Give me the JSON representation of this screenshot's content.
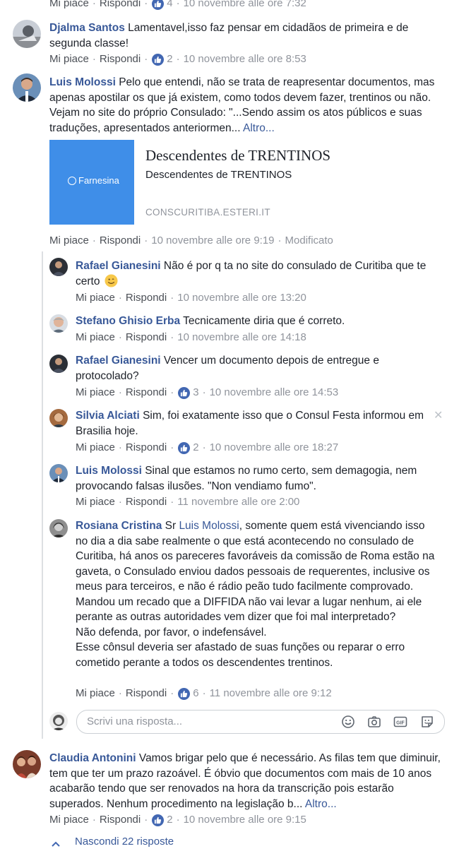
{
  "top_meta": {
    "like": "Mi piace",
    "reply": "Rispondi",
    "count": "4",
    "time": "10 novembre alle ore 7:32"
  },
  "comments": [
    {
      "author": "Djalma Santos",
      "text": "Lamentavel,isso faz pensar em cidadãos de primeira e de segunda classe!",
      "like": "Mi piace",
      "reply": "Rispondi",
      "count": "2",
      "time": "10 novembre alle ore 8:53"
    },
    {
      "author": "Luis Molossi",
      "text": "Pelo que entendi, não se trata de reapresentar documentos, mas apenas apostilar os que já existem, como todos devem fazer, trentinos ou não. Vejam no site do próprio Consulado: \"...Sendo assim os atos públicos e suas traduções, apresentados anteriormen...",
      "more": "Altro...",
      "like": "Mi piace",
      "reply": "Rispondi",
      "time": "10 novembre alle ore 9:19",
      "edited": "Modificato",
      "preview": {
        "logo": "Farnesina",
        "title": "Descendentes de TRENTINOS",
        "desc": "Descendentes de TRENTINOS",
        "domain": "CONSCURITIBA.ESTERI.IT"
      }
    },
    {
      "author": "Claudia Antonini",
      "text": "Vamos brigar pelo que é necessário. As filas tem que diminuir, tem que ter um prazo razoável. É óbvio que documentos com mais de 10 anos acabarão tendo que ser renovados na hora da transcrição pois estarão superados. Nenhum procedimento na legislação b...",
      "more": "Altro...",
      "like": "Mi piace",
      "reply": "Rispondi",
      "count": "2",
      "time": "10 novembre alle ore 9:15"
    }
  ],
  "replies": [
    {
      "author": "Rafael Gianesini",
      "text": "Não é por q ta no site do consulado de Curitiba que te certo",
      "like": "Mi piace",
      "reply": "Rispondi",
      "time": "10 novembre alle ore 13:20"
    },
    {
      "author": "Stefano Ghisio Erba",
      "text": "Tecnicamente diria que é correto.",
      "like": "Mi piace",
      "reply": "Rispondi",
      "time": "10 novembre alle ore 14:18"
    },
    {
      "author": "Rafael Gianesini",
      "text": "Vencer um documento depois de entregue e protocolado?",
      "like": "Mi piace",
      "reply": "Rispondi",
      "count": "3",
      "time": "10 novembre alle ore 14:53"
    },
    {
      "author": "Silvia Alciati",
      "text": "Sim, foi exatamente isso que o Consul Festa informou em Brasilia hoje.",
      "like": "Mi piace",
      "reply": "Rispondi",
      "count": "2",
      "time": "10 novembre alle ore 18:27"
    },
    {
      "author": "Luis Molossi",
      "text": "Sinal que estamos no rumo certo, sem demagogia, nem provocando falsas ilusões. \"Non vendiamo fumo\".",
      "like": "Mi piace",
      "reply": "Rispondi",
      "time": "11 novembre alle ore 2:00"
    },
    {
      "author": "Rosiana Cristina",
      "prefix": "Sr",
      "mention": "Luis Molossi",
      "text": ", somente quem está vivenciando isso no dia a dia sabe realmente o que está acontecendo no consulado de Curitiba, há anos os pareceres favoráveis da comissão de Roma estão na gaveta, o Consulado enviou dados pessoais de requerentes, inclusive os meus para terceiros, e não é rádio peão tudo facilmente comprovado. Mandou um recado que a DIFFIDA não vai levar a lugar nenhum, ai ele perante as outras autoridades vem dizer que foi mal interpretado?",
      "text2": "Não defenda, por favor, o indefensável.",
      "text3": "Esse cônsul deveria ser afastado de suas funções ou reparar o erro cometido perante a todos os descendentes trentinos.",
      "like": "Mi piace",
      "reply": "Rispondi",
      "count": "6",
      "time": "11 novembre alle ore 9:12"
    }
  ],
  "reply_box": {
    "placeholder": "Scrivi una risposta..."
  },
  "hide_replies": "Nascondi 22 risposte",
  "dot": "·",
  "icons": {
    "like": "thumbs-up-icon",
    "emoji": "smile-icon",
    "camera": "camera-icon",
    "gif": "gif-icon",
    "sticker": "sticker-icon",
    "close": "close-icon",
    "chevron": "chevron-up-icon"
  },
  "colors": {
    "link": "#385898",
    "meta": "#90949c",
    "like_badge": "#4267b2",
    "preview_bg": "#3f8ee8"
  }
}
